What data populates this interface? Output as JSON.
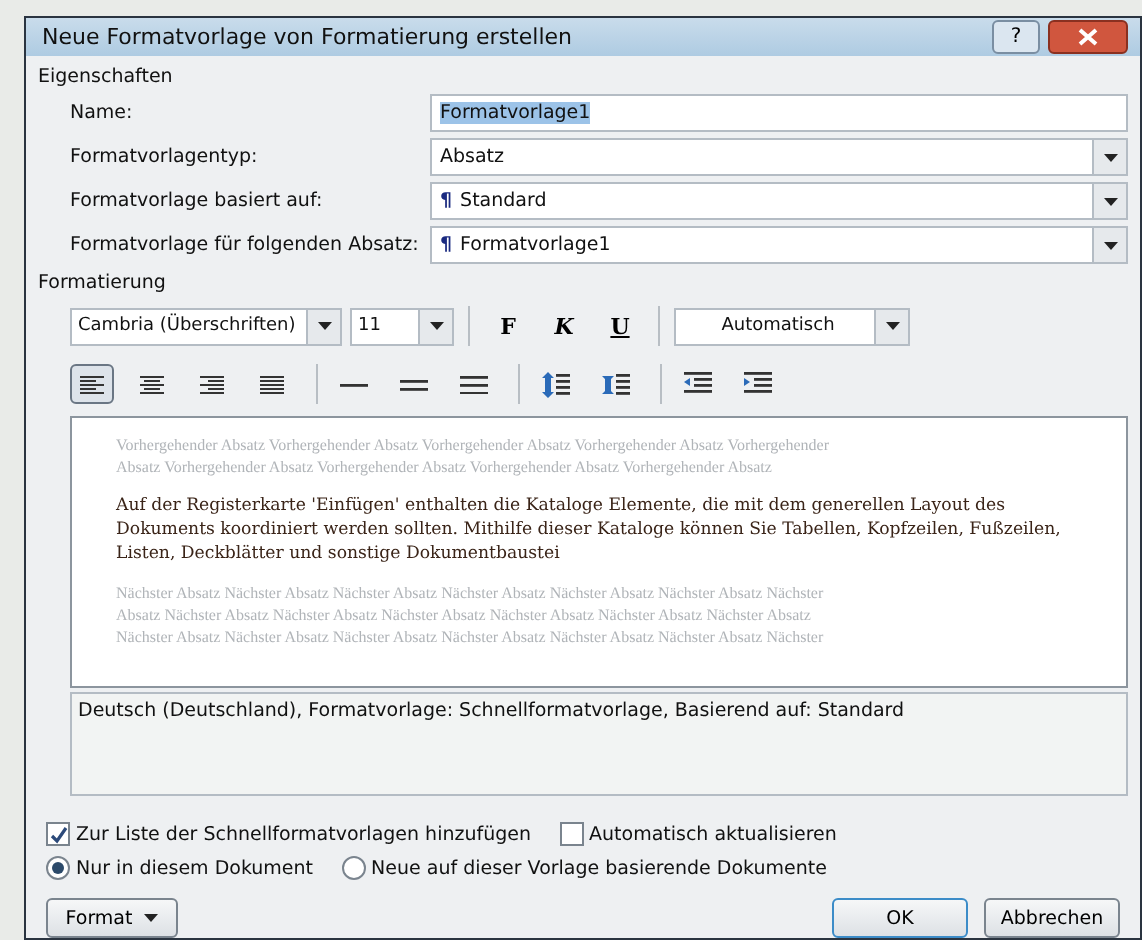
{
  "window": {
    "title": "Neue Formatvorlage von Formatierung erstellen",
    "help_button": "?"
  },
  "properties": {
    "heading": "Eigenschaften",
    "fields": [
      {
        "label": "Name:",
        "value": "Formatvorlage1",
        "kind": "text",
        "highlighted": true
      },
      {
        "label": "Formatvorlagentyp:",
        "value": "Absatz",
        "kind": "dropdown"
      },
      {
        "label": "Formatvorlage basiert auf:",
        "symbol": "¶",
        "value": "Standard",
        "kind": "dropdown"
      },
      {
        "label": "Formatvorlage für folgenden Absatz:",
        "symbol": "¶",
        "value": "Formatvorlage1",
        "kind": "dropdown"
      }
    ]
  },
  "formatting": {
    "heading": "Formatierung",
    "font": "Cambria (Überschriften)",
    "size": "11",
    "style_buttons": [
      {
        "label": "F",
        "kind": "bold"
      },
      {
        "label": "K",
        "kind": "italic"
      },
      {
        "label": "U",
        "kind": "underline"
      }
    ],
    "font_color_setting": "Automatisch",
    "paragraph_buttons": [
      {
        "kind": "align-left",
        "selected": true
      },
      {
        "kind": "align-center",
        "selected": false
      },
      {
        "kind": "align-right",
        "selected": false
      },
      {
        "kind": "justify",
        "selected": false
      },
      {
        "kind": "single-spacing",
        "selected": false
      },
      {
        "kind": "medium-spacing",
        "selected": false
      },
      {
        "kind": "double-spacing",
        "selected": false
      },
      {
        "kind": "space-before",
        "selected": false
      },
      {
        "kind": "space-after",
        "selected": false
      },
      {
        "kind": "outdent",
        "selected": false
      },
      {
        "kind": "indent",
        "selected": false
      }
    ]
  },
  "preview": {
    "previous_lines": [
      "Vorhergehender Absatz Vorhergehender Absatz Vorhergehender Absatz Vorhergehender Absatz Vorhergehender",
      "Absatz Vorhergehender Absatz Vorhergehender Absatz Vorhergehender Absatz Vorhergehender Absatz"
    ],
    "sample": "Auf der Registerkarte 'Einfügen' enthalten die Kataloge Elemente, die mit dem generellen Layout des Dokuments koordiniert werden sollten. Mithilfe dieser Kataloge können Sie Tabellen, Kopfzeilen, Fußzeilen, Listen, Deckblätter und sonstige Dokumentbaustei",
    "next_lines": [
      "Nächster Absatz Nächster Absatz Nächster Absatz Nächster Absatz Nächster Absatz Nächster Absatz Nächster",
      "Absatz Nächster Absatz Nächster Absatz Nächster Absatz Nächster Absatz Nächster Absatz Nächster Absatz",
      "Nächster Absatz Nächster Absatz Nächster Absatz Nächster Absatz Nächster Absatz Nächster Absatz Nächster"
    ]
  },
  "description": "Deutsch (Deutschland), Formatvorlage: Schnellformatvorlage, Basierend auf: Standard",
  "checkboxes": [
    {
      "label": "Zur Liste der Schnellformatvorlagen hinzufügen",
      "checked": true
    },
    {
      "label": "Automatisch aktualisieren",
      "checked": false
    }
  ],
  "radios": [
    {
      "label": "Nur in diesem Dokument",
      "selected": true
    },
    {
      "label": "Neue auf dieser Vorlage basierende Dokumente",
      "selected": false
    }
  ],
  "buttons": [
    {
      "label": "Format",
      "kind": "menu"
    },
    {
      "label": "OK",
      "kind": "default"
    },
    {
      "label": "Abbrechen",
      "kind": "plain"
    }
  ]
}
